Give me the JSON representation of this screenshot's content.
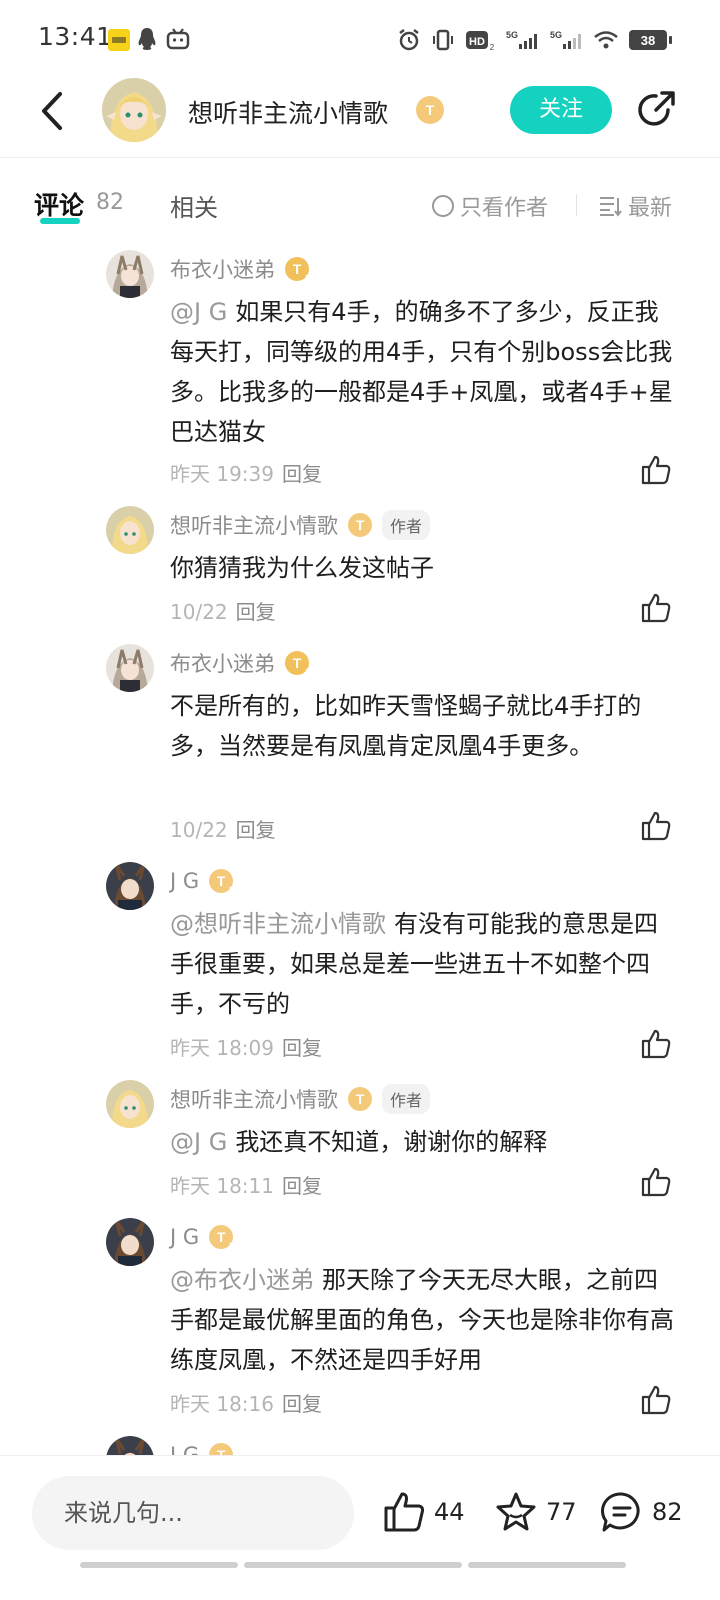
{
  "status_bar": {
    "time": "13:41",
    "battery": "38"
  },
  "header": {
    "title": "想听非主流小情歌",
    "level": "T",
    "level_sub": "4",
    "follow_label": "关注"
  },
  "tabs": {
    "comments_label": "评论",
    "comments_count": "82",
    "related_label": "相关",
    "only_author_label": "只看作者",
    "sort_label": "最新"
  },
  "comments": [
    {
      "name": "布衣小迷弟",
      "level": "T",
      "level_sub": "1",
      "is_author": false,
      "mention": "@J G",
      "text": "如果只有4手，的确多不了多少，反正我每天打，同等级的用4手，只有个别boss会比我多。比我多的一般都是4手+凤凰，或者4手+星巴达猫女",
      "time": "昨天 19:39",
      "reply": "回复"
    },
    {
      "name": "想听非主流小情歌",
      "level": "T",
      "level_sub": "4",
      "is_author": true,
      "author_tag": "作者",
      "mention": "",
      "text": "你猜猜我为什么发这帖子",
      "time": "10/22",
      "reply": "回复"
    },
    {
      "name": "布衣小迷弟",
      "level": "T",
      "level_sub": "1",
      "is_author": false,
      "mention": "",
      "text": "不是所有的，比如昨天雪怪蝎子就比4手打的多，当然要是有凤凰肯定凤凰4手更多。",
      "time": "10/22",
      "reply": "回复"
    },
    {
      "name": "J G",
      "level": "T",
      "level_sub": "5",
      "is_author": false,
      "mention": "@想听非主流小情歌",
      "text": "有没有可能我的意思是四手很重要，如果总是差一些进五十不如整个四手，不亏的",
      "time": "昨天 18:09",
      "reply": "回复"
    },
    {
      "name": "想听非主流小情歌",
      "level": "T",
      "level_sub": "4",
      "is_author": true,
      "author_tag": "作者",
      "mention": "@J G",
      "text": "我还真不知道，谢谢你的解释",
      "time": "昨天 18:11",
      "reply": "回复"
    },
    {
      "name": "J G",
      "level": "T",
      "level_sub": "5",
      "is_author": false,
      "mention": "@布衣小迷弟",
      "text": "那天除了今天无尽大眼，之前四手都是最优解里面的角色，今天也是除非你有高练度凤凰，不然还是四手好用",
      "time": "昨天 18:16",
      "reply": "回复"
    },
    {
      "name": "J G",
      "level": "T",
      "level_sub": "5",
      "is_author": false,
      "mention": "",
      "text": "",
      "time": "",
      "reply": ""
    }
  ],
  "bottom_bar": {
    "input_placeholder": "来说几句...",
    "like_count": "44",
    "star_count": "77",
    "comment_count": "82"
  },
  "colors": {
    "accent": "#15d1c0",
    "badge": "#f2c05a",
    "meta": "#b5b5b5"
  }
}
